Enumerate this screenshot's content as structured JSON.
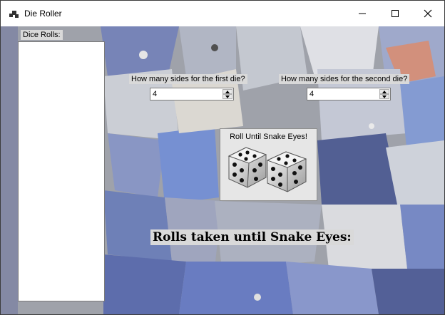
{
  "window": {
    "title": "Die Roller",
    "icons": {
      "app": "app-icon",
      "minimize": "minimize-icon",
      "maximize": "maximize-icon",
      "close": "close-icon"
    }
  },
  "rolls": {
    "label": "Dice Rolls:",
    "items": []
  },
  "first_die": {
    "label": "How many sides for the first die?",
    "value": "4"
  },
  "second_die": {
    "label": "How many sides for the second die?",
    "value": "4"
  },
  "roll_button": {
    "label": "Roll Until Snake Eyes!",
    "icon": "dice-icon"
  },
  "result": {
    "label": "Rolls taken until Snake Eyes:"
  },
  "colors": {
    "background_image": "dice-collage",
    "label_bg": "#d9d9d9"
  }
}
